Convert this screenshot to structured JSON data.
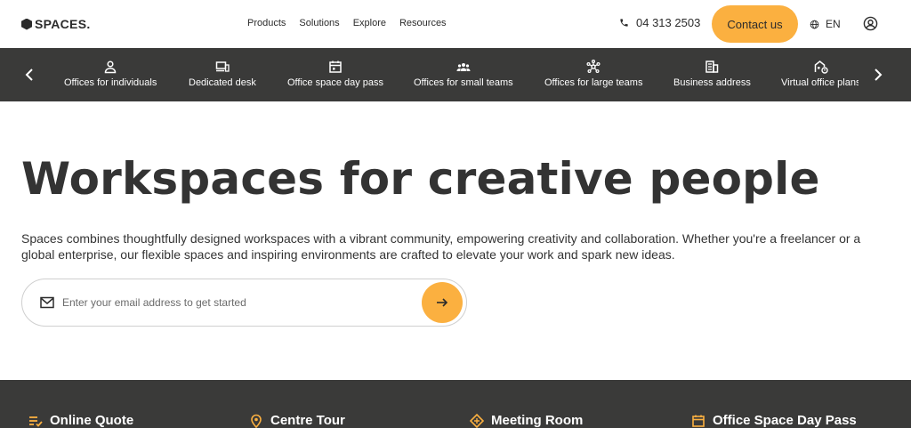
{
  "header": {
    "logo_text": "SPACES.",
    "nav": [
      "Products",
      "Solutions",
      "Explore",
      "Resources"
    ],
    "phone": "04 313 2503",
    "contact_label": "Contact us",
    "language": "EN"
  },
  "categories": [
    {
      "label": "Offices for individuals",
      "icon": "person-icon"
    },
    {
      "label": "Dedicated desk",
      "icon": "desk-icon"
    },
    {
      "label": "Office space day pass",
      "icon": "calendar-icon"
    },
    {
      "label": "Offices for small teams",
      "icon": "team-icon"
    },
    {
      "label": "Offices for large teams",
      "icon": "network-icon"
    },
    {
      "label": "Business address",
      "icon": "building-icon"
    },
    {
      "label": "Virtual office plans",
      "icon": "virtual-office-icon"
    }
  ],
  "hero": {
    "title": "Workspaces for creative people",
    "description": "Spaces combines thoughtfully designed workspaces with a vibrant community, empowering creativity and collaboration. Whether you're a freelancer or a global enterprise, our flexible spaces and inspiring environments are crafted to elevate your work and spark new ideas.",
    "email_placeholder": "Enter your email address to get started"
  },
  "quick_links": [
    {
      "label": "Online Quote",
      "icon": "quote-list-icon"
    },
    {
      "label": "Centre Tour",
      "icon": "location-pin-icon"
    },
    {
      "label": "Meeting Room",
      "icon": "meeting-room-icon"
    },
    {
      "label": "Office Space Day Pass",
      "icon": "calendar-icon"
    }
  ],
  "colors": {
    "accent": "#fbb040",
    "dark_band": "#3a3a39",
    "text": "#333333"
  }
}
